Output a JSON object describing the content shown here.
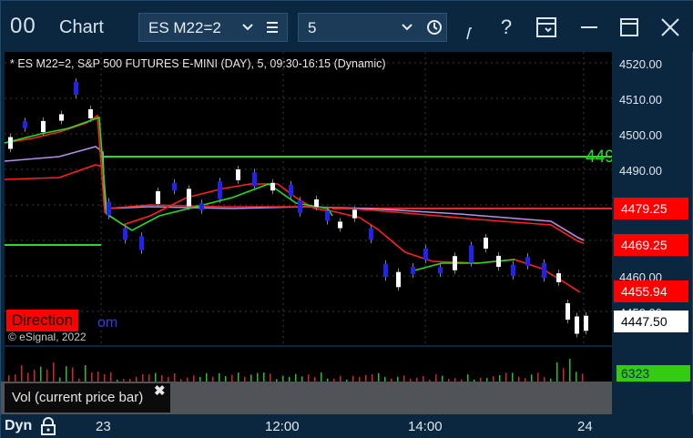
{
  "window": {
    "logo_glyph": "00",
    "title": "Chart"
  },
  "toolbar": {
    "symbol_value": "ES M22=2",
    "interval_value": "5",
    "icons": [
      "list-icon",
      "chevron-down-icon",
      "clock-icon",
      "draw-icon",
      "help-icon",
      "template-icon",
      "minimize-icon",
      "maximize-icon",
      "close-icon"
    ],
    "help_label": "?"
  },
  "chart": {
    "header": "* ES M22=2, S&P 500 FUTURES E-MINI (DAY), 5, 09:30-16:15 (Dynamic)",
    "direction_label": "Direction",
    "direction_extra": "om",
    "copyright": "© eSignal, 2022",
    "partial_level_label": "449",
    "price_ticks": [
      "4520.00",
      "4510.00",
      "4500.00",
      "4490.00",
      "4460.00",
      "4450.00"
    ],
    "price_tags": [
      {
        "label": "4479.25",
        "bg": "#ff0000",
        "fg": "#ffffff"
      },
      {
        "label": "4469.25",
        "bg": "#ff0000",
        "fg": "#ffffff"
      },
      {
        "label": "4455.94",
        "bg": "#ff0000",
        "fg": "#ffffff"
      },
      {
        "label": "4447.50",
        "bg": "#ffffff",
        "fg": "#000000"
      }
    ],
    "colors": {
      "bull_candle": "#ffffff",
      "bear_candle": "#2222ee",
      "red_line": "#ff2020",
      "green_line": "#22dd22",
      "purple_line": "#b690e8",
      "grid": "#3a3a3a"
    }
  },
  "volume": {
    "label": "Vol (current price bar)",
    "close_glyph": "✖",
    "value": "6323"
  },
  "time_axis": {
    "mode_label": "Dyn",
    "ticks": [
      "23",
      "12:00",
      "14:00",
      "24"
    ]
  }
}
